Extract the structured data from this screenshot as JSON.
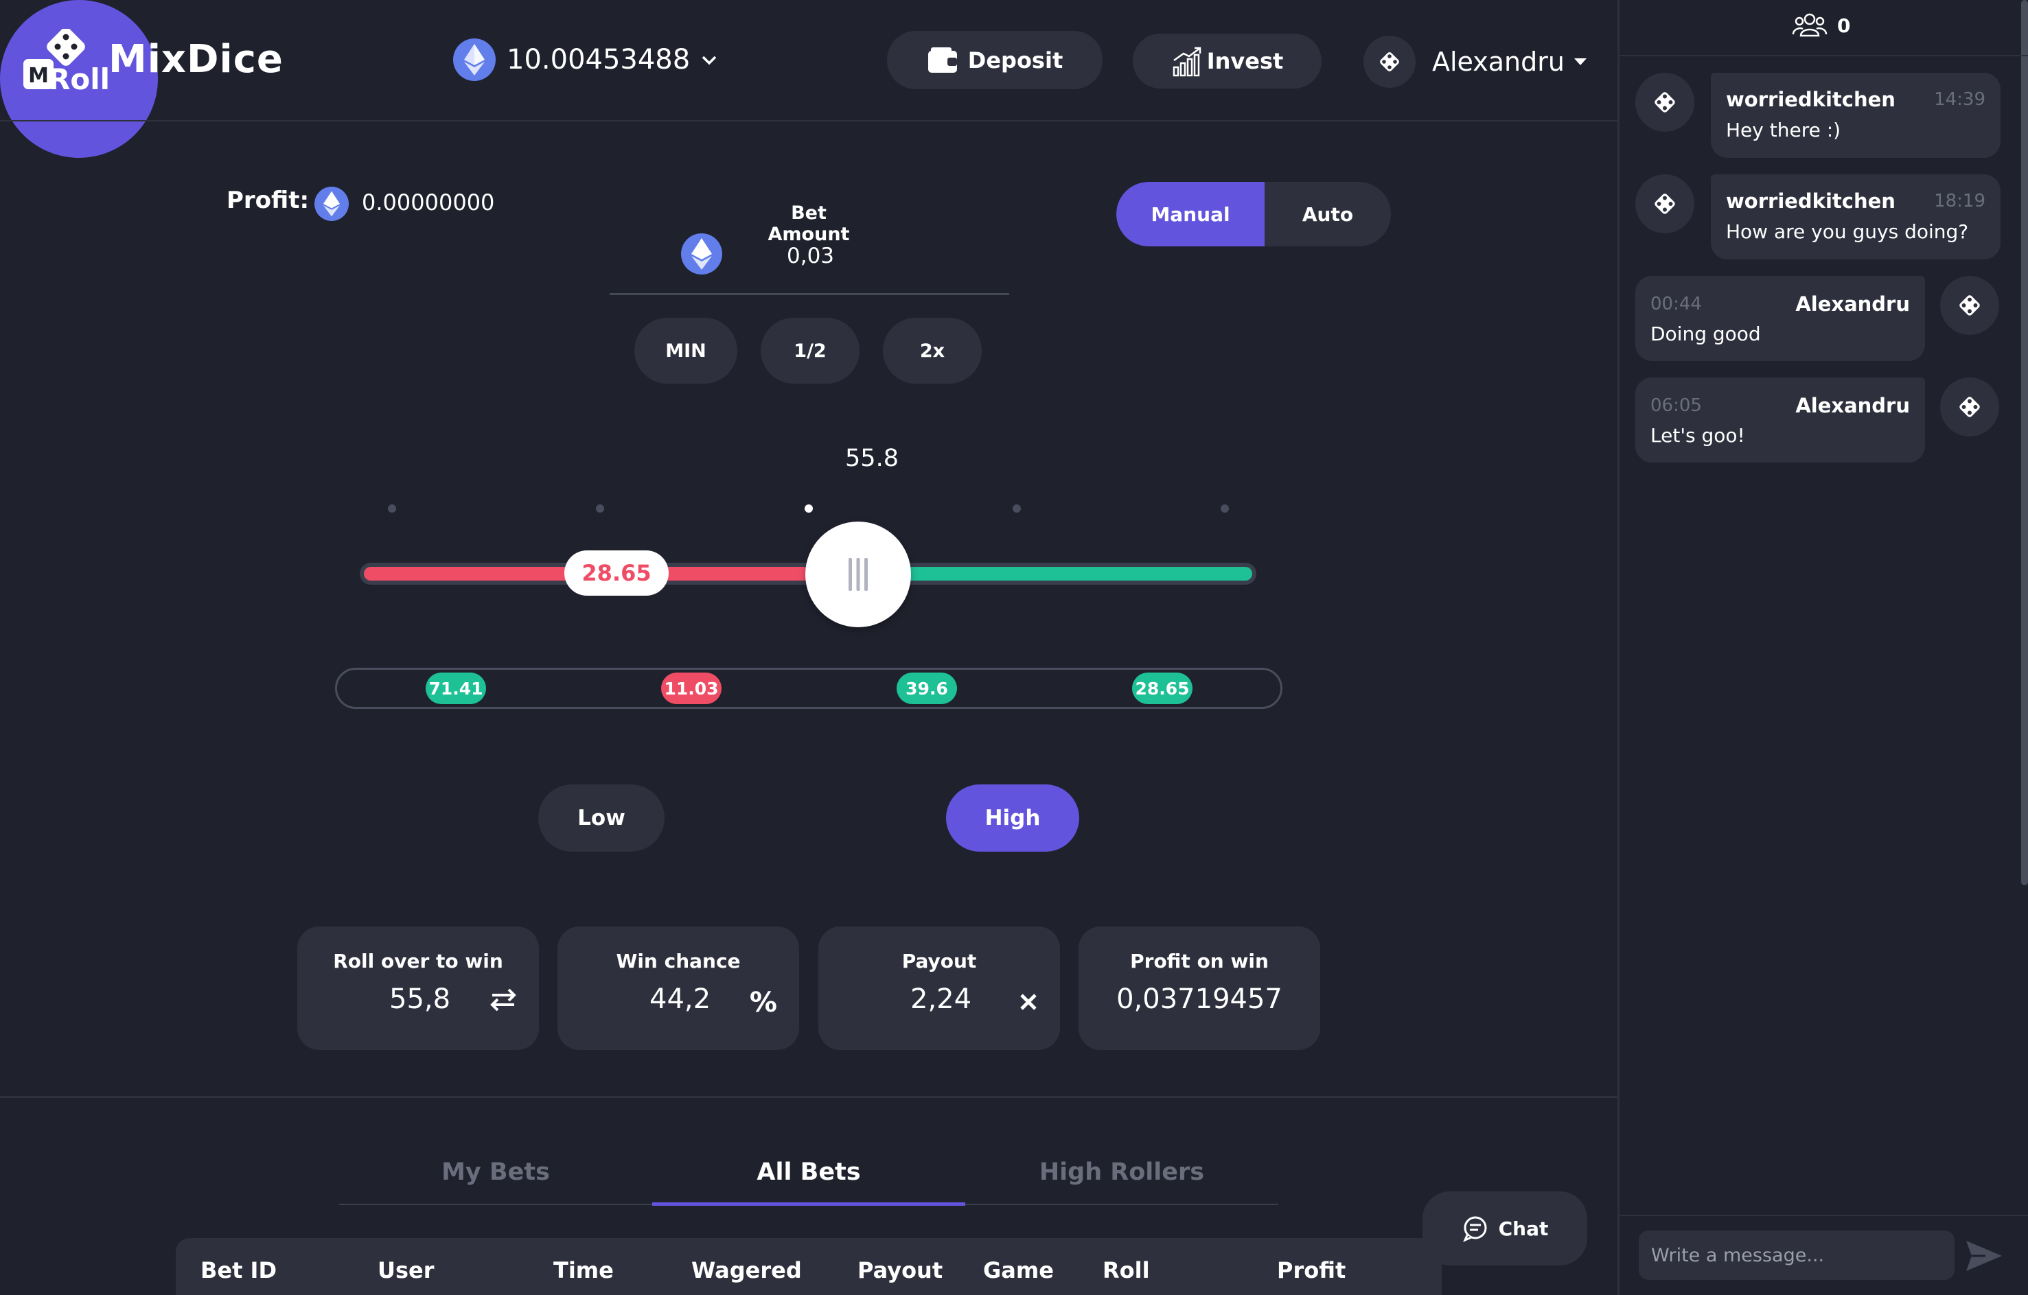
{
  "header": {
    "logo_letter": "M",
    "logo_text": "MixDice",
    "balance": "10.00453488",
    "deposit_label": "Deposit",
    "invest_label": "Invest",
    "user_name": "Alexandru"
  },
  "game": {
    "profit_label": "Profit:",
    "profit_value": "0.00000000",
    "bet_amount_label": "Bet Amount",
    "bet_amount_value": "0,03",
    "min_label": "MIN",
    "half_label": "1/2",
    "double_label": "2x",
    "mode_manual": "Manual",
    "mode_auto": "Auto",
    "slider_value": "55.8",
    "result_value": "28.65",
    "history": [
      {
        "value": "71.41",
        "status": "win"
      },
      {
        "value": "11.03",
        "status": "loss"
      },
      {
        "value": "39.6",
        "status": "win"
      },
      {
        "value": "28.65",
        "status": "win"
      }
    ],
    "low_label": "Low",
    "roll_label": "Roll",
    "high_label": "High",
    "stats": {
      "roll_over_label": "Roll over to win",
      "roll_over_value": "55,8",
      "win_chance_label": "Win chance",
      "win_chance_value": "44,2",
      "win_chance_unit": "%",
      "payout_label": "Payout",
      "payout_value": "2,24",
      "profit_on_win_label": "Profit on win",
      "profit_on_win_value": "0,03719457"
    }
  },
  "bets": {
    "tabs": [
      "My Bets",
      "All Bets",
      "High Rollers"
    ],
    "active_tab": "All Bets",
    "columns": [
      "Bet ID",
      "User",
      "Time",
      "Wagered",
      "Payout",
      "Game",
      "Roll",
      "Profit"
    ]
  },
  "chat": {
    "online_count": "0",
    "float_label": "Chat",
    "messages": [
      {
        "user": "worriedkitchen",
        "time": "14:39",
        "text": "Hey there :)"
      },
      {
        "user": "worriedkitchen",
        "time": "18:19",
        "text": "How are you guys doing?"
      },
      {
        "user": "Alexandru",
        "time": "00:44",
        "text": "Doing good"
      },
      {
        "user": "Alexandru",
        "time": "06:05",
        "text": "Let's goo!"
      }
    ],
    "input_placeholder": "Write a message..."
  },
  "colors": {
    "background": "#1f212d",
    "panel": "#2e303d",
    "accent": "#6254dd",
    "win": "#1ec095",
    "loss": "#ef4d66",
    "eth": "#627eea"
  },
  "icons": [
    "dice-logo-icon",
    "eth-icon",
    "chevron-down-icon",
    "wallet-icon",
    "invest-chart-icon",
    "avatar-icon",
    "swap-icon",
    "percent-icon",
    "close-icon",
    "users-icon",
    "chat-bubble-icon",
    "send-icon"
  ]
}
